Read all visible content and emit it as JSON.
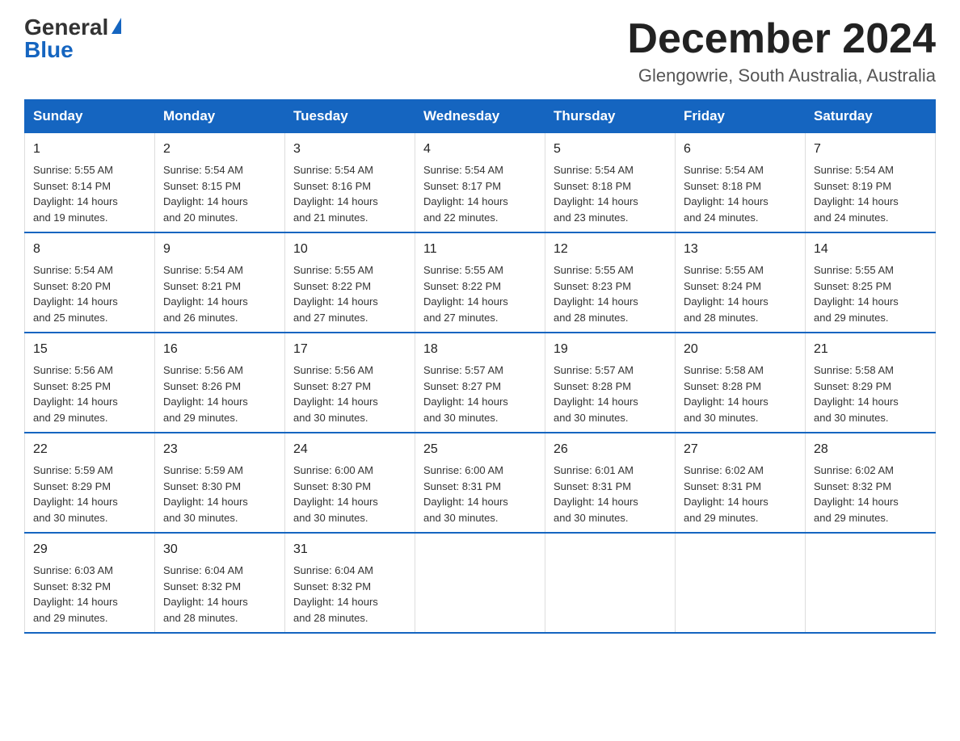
{
  "logo": {
    "general": "General",
    "blue": "Blue"
  },
  "header": {
    "month_year": "December 2024",
    "location": "Glengowrie, South Australia, Australia"
  },
  "days_of_week": [
    "Sunday",
    "Monday",
    "Tuesday",
    "Wednesday",
    "Thursday",
    "Friday",
    "Saturday"
  ],
  "weeks": [
    [
      {
        "day": "1",
        "sunrise": "Sunrise: 5:55 AM",
        "sunset": "Sunset: 8:14 PM",
        "daylight": "Daylight: 14 hours",
        "daylight2": "and 19 minutes."
      },
      {
        "day": "2",
        "sunrise": "Sunrise: 5:54 AM",
        "sunset": "Sunset: 8:15 PM",
        "daylight": "Daylight: 14 hours",
        "daylight2": "and 20 minutes."
      },
      {
        "day": "3",
        "sunrise": "Sunrise: 5:54 AM",
        "sunset": "Sunset: 8:16 PM",
        "daylight": "Daylight: 14 hours",
        "daylight2": "and 21 minutes."
      },
      {
        "day": "4",
        "sunrise": "Sunrise: 5:54 AM",
        "sunset": "Sunset: 8:17 PM",
        "daylight": "Daylight: 14 hours",
        "daylight2": "and 22 minutes."
      },
      {
        "day": "5",
        "sunrise": "Sunrise: 5:54 AM",
        "sunset": "Sunset: 8:18 PM",
        "daylight": "Daylight: 14 hours",
        "daylight2": "and 23 minutes."
      },
      {
        "day": "6",
        "sunrise": "Sunrise: 5:54 AM",
        "sunset": "Sunset: 8:18 PM",
        "daylight": "Daylight: 14 hours",
        "daylight2": "and 24 minutes."
      },
      {
        "day": "7",
        "sunrise": "Sunrise: 5:54 AM",
        "sunset": "Sunset: 8:19 PM",
        "daylight": "Daylight: 14 hours",
        "daylight2": "and 24 minutes."
      }
    ],
    [
      {
        "day": "8",
        "sunrise": "Sunrise: 5:54 AM",
        "sunset": "Sunset: 8:20 PM",
        "daylight": "Daylight: 14 hours",
        "daylight2": "and 25 minutes."
      },
      {
        "day": "9",
        "sunrise": "Sunrise: 5:54 AM",
        "sunset": "Sunset: 8:21 PM",
        "daylight": "Daylight: 14 hours",
        "daylight2": "and 26 minutes."
      },
      {
        "day": "10",
        "sunrise": "Sunrise: 5:55 AM",
        "sunset": "Sunset: 8:22 PM",
        "daylight": "Daylight: 14 hours",
        "daylight2": "and 27 minutes."
      },
      {
        "day": "11",
        "sunrise": "Sunrise: 5:55 AM",
        "sunset": "Sunset: 8:22 PM",
        "daylight": "Daylight: 14 hours",
        "daylight2": "and 27 minutes."
      },
      {
        "day": "12",
        "sunrise": "Sunrise: 5:55 AM",
        "sunset": "Sunset: 8:23 PM",
        "daylight": "Daylight: 14 hours",
        "daylight2": "and 28 minutes."
      },
      {
        "day": "13",
        "sunrise": "Sunrise: 5:55 AM",
        "sunset": "Sunset: 8:24 PM",
        "daylight": "Daylight: 14 hours",
        "daylight2": "and 28 minutes."
      },
      {
        "day": "14",
        "sunrise": "Sunrise: 5:55 AM",
        "sunset": "Sunset: 8:25 PM",
        "daylight": "Daylight: 14 hours",
        "daylight2": "and 29 minutes."
      }
    ],
    [
      {
        "day": "15",
        "sunrise": "Sunrise: 5:56 AM",
        "sunset": "Sunset: 8:25 PM",
        "daylight": "Daylight: 14 hours",
        "daylight2": "and 29 minutes."
      },
      {
        "day": "16",
        "sunrise": "Sunrise: 5:56 AM",
        "sunset": "Sunset: 8:26 PM",
        "daylight": "Daylight: 14 hours",
        "daylight2": "and 29 minutes."
      },
      {
        "day": "17",
        "sunrise": "Sunrise: 5:56 AM",
        "sunset": "Sunset: 8:27 PM",
        "daylight": "Daylight: 14 hours",
        "daylight2": "and 30 minutes."
      },
      {
        "day": "18",
        "sunrise": "Sunrise: 5:57 AM",
        "sunset": "Sunset: 8:27 PM",
        "daylight": "Daylight: 14 hours",
        "daylight2": "and 30 minutes."
      },
      {
        "day": "19",
        "sunrise": "Sunrise: 5:57 AM",
        "sunset": "Sunset: 8:28 PM",
        "daylight": "Daylight: 14 hours",
        "daylight2": "and 30 minutes."
      },
      {
        "day": "20",
        "sunrise": "Sunrise: 5:58 AM",
        "sunset": "Sunset: 8:28 PM",
        "daylight": "Daylight: 14 hours",
        "daylight2": "and 30 minutes."
      },
      {
        "day": "21",
        "sunrise": "Sunrise: 5:58 AM",
        "sunset": "Sunset: 8:29 PM",
        "daylight": "Daylight: 14 hours",
        "daylight2": "and 30 minutes."
      }
    ],
    [
      {
        "day": "22",
        "sunrise": "Sunrise: 5:59 AM",
        "sunset": "Sunset: 8:29 PM",
        "daylight": "Daylight: 14 hours",
        "daylight2": "and 30 minutes."
      },
      {
        "day": "23",
        "sunrise": "Sunrise: 5:59 AM",
        "sunset": "Sunset: 8:30 PM",
        "daylight": "Daylight: 14 hours",
        "daylight2": "and 30 minutes."
      },
      {
        "day": "24",
        "sunrise": "Sunrise: 6:00 AM",
        "sunset": "Sunset: 8:30 PM",
        "daylight": "Daylight: 14 hours",
        "daylight2": "and 30 minutes."
      },
      {
        "day": "25",
        "sunrise": "Sunrise: 6:00 AM",
        "sunset": "Sunset: 8:31 PM",
        "daylight": "Daylight: 14 hours",
        "daylight2": "and 30 minutes."
      },
      {
        "day": "26",
        "sunrise": "Sunrise: 6:01 AM",
        "sunset": "Sunset: 8:31 PM",
        "daylight": "Daylight: 14 hours",
        "daylight2": "and 30 minutes."
      },
      {
        "day": "27",
        "sunrise": "Sunrise: 6:02 AM",
        "sunset": "Sunset: 8:31 PM",
        "daylight": "Daylight: 14 hours",
        "daylight2": "and 29 minutes."
      },
      {
        "day": "28",
        "sunrise": "Sunrise: 6:02 AM",
        "sunset": "Sunset: 8:32 PM",
        "daylight": "Daylight: 14 hours",
        "daylight2": "and 29 minutes."
      }
    ],
    [
      {
        "day": "29",
        "sunrise": "Sunrise: 6:03 AM",
        "sunset": "Sunset: 8:32 PM",
        "daylight": "Daylight: 14 hours",
        "daylight2": "and 29 minutes."
      },
      {
        "day": "30",
        "sunrise": "Sunrise: 6:04 AM",
        "sunset": "Sunset: 8:32 PM",
        "daylight": "Daylight: 14 hours",
        "daylight2": "and 28 minutes."
      },
      {
        "day": "31",
        "sunrise": "Sunrise: 6:04 AM",
        "sunset": "Sunset: 8:32 PM",
        "daylight": "Daylight: 14 hours",
        "daylight2": "and 28 minutes."
      },
      null,
      null,
      null,
      null
    ]
  ],
  "colors": {
    "header_bg": "#1565c0",
    "header_text": "#ffffff",
    "border": "#1565c0",
    "cell_border": "#ddd"
  }
}
